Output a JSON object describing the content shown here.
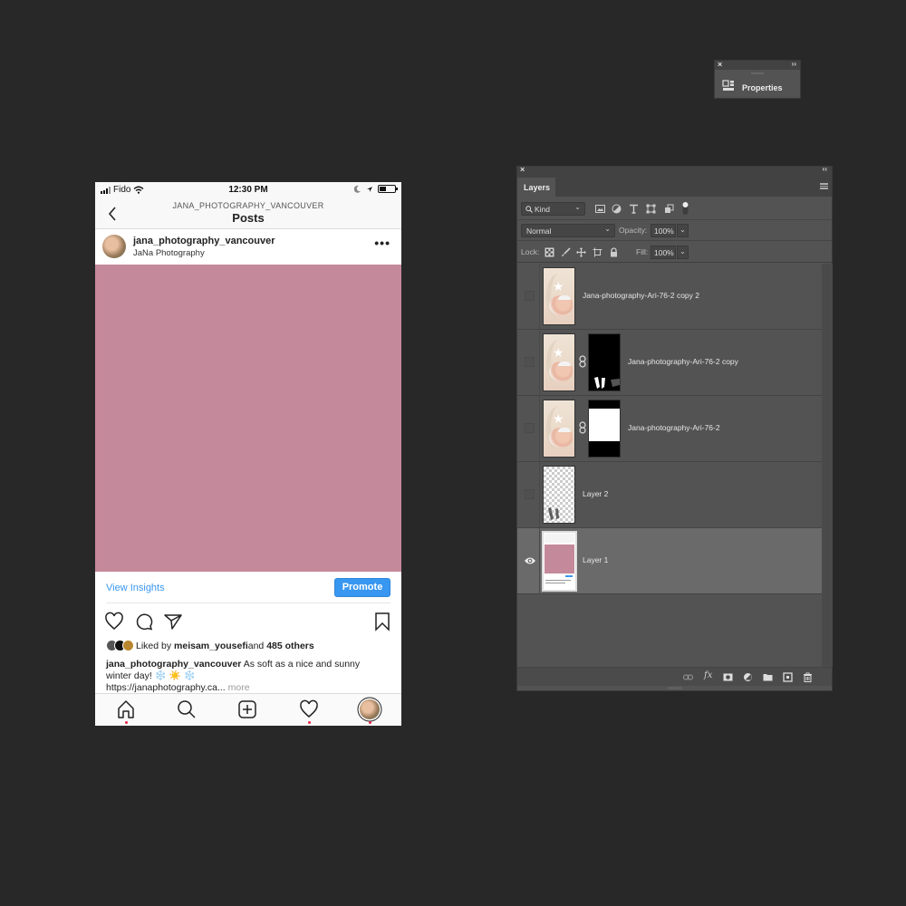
{
  "phone": {
    "status": {
      "carrier": "Fido",
      "time": "12:30 PM"
    },
    "nav": {
      "back_icon": "chevron-left-icon",
      "subtitle": "JANA_PHOTOGRAPHY_VANCOUVER",
      "title": "Posts"
    },
    "post_header": {
      "username": "jana_photography_vancouver",
      "display_name": "JaNa Photography",
      "more_label": "•••"
    },
    "post_image_color": "#c4899a",
    "insights": {
      "view_label": "View Insights",
      "promote_label": "Promote"
    },
    "likes": {
      "prefix": "Liked by ",
      "user": "meisam_yousefi",
      "middle": " and ",
      "count": "485 others"
    },
    "caption": {
      "username": "jana_photography_vancouver",
      "text": " As soft as a nice and sunny winter day! ❄️ ☀️ ❄️",
      "link": "https://janaphotography.ca...",
      "more": " more"
    },
    "accent_color": "#3897f0",
    "tabbar": [
      "home-icon",
      "search-icon",
      "new-post-icon",
      "activity-icon",
      "profile-avatar"
    ]
  },
  "properties_panel": {
    "title": "Properties",
    "close": "×",
    "collapse": "››"
  },
  "layers_panel": {
    "close": "×",
    "collapse": "‹‹",
    "tab": "Layers",
    "filter_kind": "Kind",
    "blend_mode": "Normal",
    "opacity_label": "Opacity:",
    "opacity": "100%",
    "lock_label": "Lock:",
    "fill_label": "Fill:",
    "fill": "100%",
    "layers": [
      {
        "name": "Jana-photography-Ari-76-2 copy 2",
        "visible": false,
        "thumb": "photo",
        "mask": null
      },
      {
        "name": "Jana-photography-Ari-76-2 copy",
        "visible": false,
        "thumb": "photo",
        "mask": "legs"
      },
      {
        "name": "Jana-photography-Ari-76-2",
        "visible": false,
        "thumb": "photo",
        "mask": "band"
      },
      {
        "name": "Layer 2",
        "visible": false,
        "thumb": "transparent",
        "mask": null
      },
      {
        "name": "Layer 1",
        "visible": true,
        "thumb": "instagram",
        "mask": null,
        "selected": true
      }
    ]
  }
}
